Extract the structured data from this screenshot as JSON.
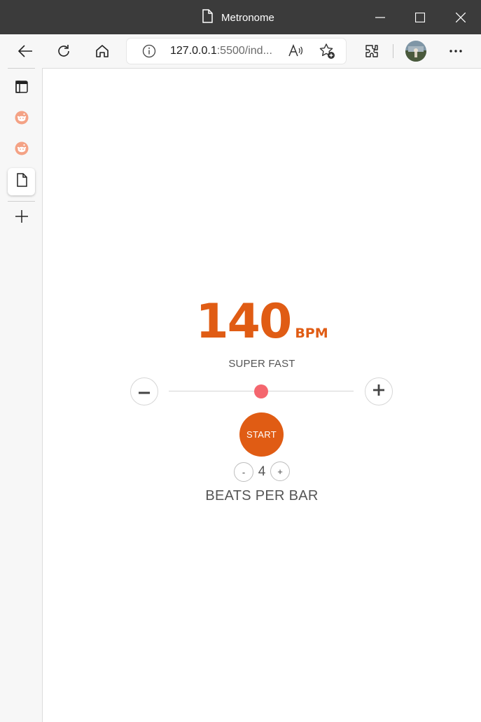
{
  "window": {
    "title": "Metronome",
    "colors": {
      "titlebar": "#3b3b3b"
    }
  },
  "browser": {
    "url_host": "127.0.0.1",
    "url_rest": ":5500/ind...",
    "icons": [
      "back-arrow-icon",
      "refresh-icon",
      "home-icon",
      "info-icon",
      "read-aloud-icon",
      "add-favorite-icon",
      "extensions-icon",
      "profile-avatar",
      "more-menu-icon"
    ]
  },
  "sidebar": {
    "items": [
      {
        "icon": "tab-panel-icon",
        "active": false
      },
      {
        "icon": "reddit-icon",
        "active": false
      },
      {
        "icon": "reddit-icon",
        "active": false
      },
      {
        "icon": "page-icon",
        "active": true
      },
      {
        "icon": "plus-icon",
        "active": false
      }
    ]
  },
  "metronome": {
    "bpm": "140",
    "bpm_unit": "BPM",
    "tempo_name": "SUPER FAST",
    "slider": {
      "value": 140,
      "min": 20,
      "max": 260
    },
    "decrease_symbol": "−",
    "increase_symbol": "+",
    "start_label": "START",
    "beats_per_bar": "4",
    "beats_minus": "-",
    "beats_plus": "+",
    "beats_label": "BEATS PER BAR",
    "colors": {
      "accent": "#e05c14",
      "slider_thumb": "#f4666e"
    }
  }
}
